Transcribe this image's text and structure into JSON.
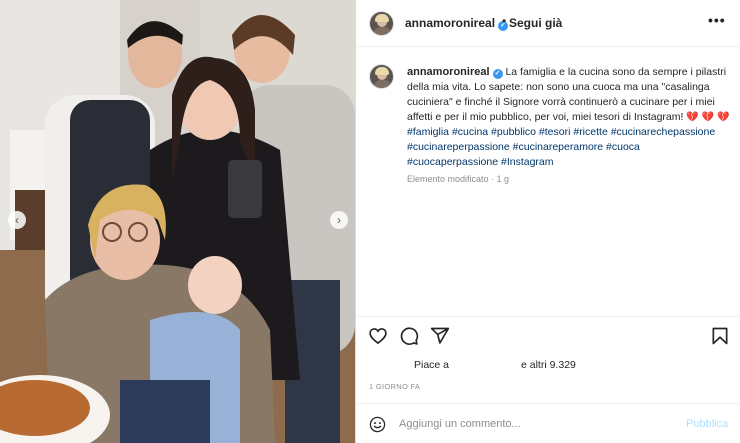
{
  "post": {
    "username": "annamoronireal",
    "verified_mark": "✓",
    "dot": "•",
    "follow_label": "Segui già",
    "more_label": "•••",
    "caption_text": "La famiglia e la cucina sono da sempre i pilastri della mia vita. Lo sapete: non sono una cuoca ma una \"casalinga cuciniera\" e finché il Signore vorrà continuerò a cucinare per i miei affetti e per il mio pubblico, per voi, miei tesori di Instagram! ",
    "hearts": "💔 💔",
    "heart_last": "💔",
    "hashtags": "#famiglia #cucina #pubblico #tesori #ricette #cucinarechepassione #cucinareperpassione #cucinareperamore #cuoca #cuocaperpassione #Instagram",
    "meta": "Elemento modificato · 1 g",
    "likes_prefix": "Piace a",
    "likes_suffix": "e altri 9.329",
    "timestamp": "1 GIORNO FA",
    "comment_placeholder": "Aggiungi un commento...",
    "post_label": "Pubblica"
  },
  "carousel": {
    "prev": "‹",
    "next": "›"
  },
  "icons": {
    "like": "heart-icon",
    "comment": "comment-icon",
    "share": "share-icon",
    "save": "bookmark-icon",
    "emoji": "emoji-icon"
  },
  "colors": {
    "link": "#00376b",
    "verified": "#3897f0",
    "publish_disabled": "#b2dffc"
  }
}
